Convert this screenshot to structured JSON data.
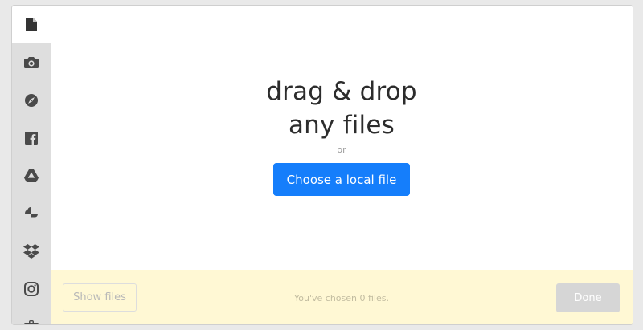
{
  "sidebar": {
    "tabs": [
      {
        "icon": "file-icon",
        "active": true
      },
      {
        "icon": "camera-icon",
        "active": false
      },
      {
        "icon": "compass-icon",
        "active": false
      },
      {
        "icon": "facebook-icon",
        "active": false
      },
      {
        "icon": "google-drive-icon",
        "active": false
      },
      {
        "icon": "google-photos-icon",
        "active": false
      },
      {
        "icon": "dropbox-icon",
        "active": false
      },
      {
        "icon": "instagram-icon",
        "active": false
      },
      {
        "icon": "briefcase-icon",
        "active": false
      }
    ]
  },
  "main": {
    "headline_line1": "drag & drop",
    "headline_line2": "any files",
    "or_text": "or",
    "choose_label": "Choose a local file"
  },
  "footer": {
    "show_files_label": "Show files",
    "chosen_text": "You've chosen 0 files.",
    "done_label": "Done"
  },
  "colors": {
    "accent": "#157efb",
    "footer_bg": "#fff8d4",
    "sidebar_bg": "#dedede",
    "icon": "#4a4a4a"
  }
}
